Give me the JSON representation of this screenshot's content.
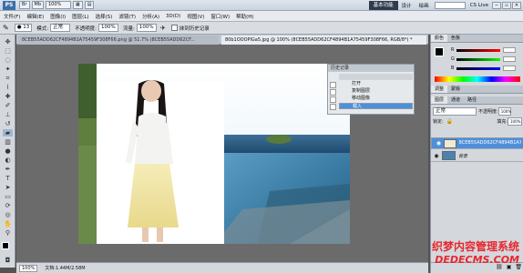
{
  "titlebar": {
    "logo": "PS",
    "mini_buttons": [
      "Br",
      "Mb"
    ],
    "zoom": "100%",
    "workspace": "基本功能",
    "workspace_links": [
      "设计",
      "绘画"
    ],
    "cs_live": "CS Live",
    "window_controls": [
      "─",
      "▫",
      "✕"
    ]
  },
  "menu": [
    "文件(F)",
    "编辑(E)",
    "图像(I)",
    "图层(L)",
    "选择(S)",
    "滤镜(T)",
    "分析(A)",
    "3D(D)",
    "视图(V)",
    "窗口(W)",
    "帮助(H)"
  ],
  "options": {
    "brush_size": "13",
    "mode_label": "模式:",
    "mode_value": "正常",
    "opacity_label": "不透明度:",
    "opacity_value": "100%",
    "flow_label": "流量:",
    "flow_value": "100%",
    "history_label": "抹到历史记录"
  },
  "tabs": [
    "8CEB55ADD62CF4894B1A75459F308F66.png @ 51.7% (8CEB55ADD62CF...",
    "80b1OOOPlGa5.jpg @ 100% (8CEB55ADD62CF4894B1A75459F308F66, RGB/8*) *"
  ],
  "status": {
    "zoom": "100%",
    "doc": "文档:1.44M/2.58M"
  },
  "history_panel": {
    "title": "历史记录",
    "items": [
      "打开",
      "复制图层",
      "移动图像",
      "载入"
    ],
    "selected_index": 3
  },
  "right_panel": {
    "color_tabs": [
      "颜色",
      "色板"
    ],
    "channels": [
      "R",
      "G",
      "B"
    ],
    "adjust_tabs": [
      "调整",
      "蒙版"
    ],
    "layer_tabs": [
      "图层",
      "通道",
      "路径"
    ],
    "blend_mode": "正常",
    "opacity_label": "不透明度:",
    "opacity_value": "100%",
    "lock_label": "锁定:",
    "fill_label": "填充:",
    "fill_value": "100%",
    "layers": [
      {
        "name": "8CEB55ADD62CF4894B1A75...",
        "selected": true
      },
      {
        "name": "背景",
        "selected": false
      }
    ]
  },
  "watermark": {
    "line1": "织梦内容管理系统",
    "line2": "DEDECMS.COM"
  }
}
